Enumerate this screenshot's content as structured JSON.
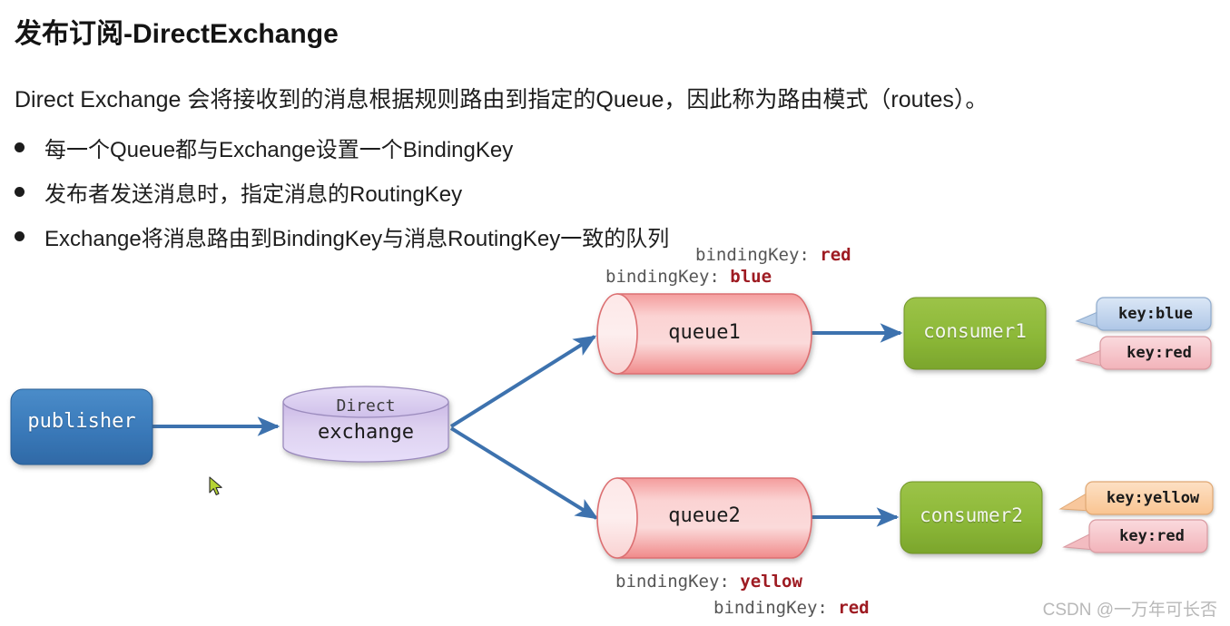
{
  "slide": {
    "title": "发布订阅-DirectExchange",
    "lead": "Direct Exchange 会将接收到的消息根据规则路由到指定的Queue，因此称为路由模式（routes）。",
    "bullets": [
      "每一个Queue都与Exchange设置一个BindingKey",
      "发布者发送消息时，指定消息的RoutingKey",
      "Exchange将消息路由到BindingKey与消息RoutingKey一致的队列"
    ]
  },
  "diagram": {
    "publisher": {
      "label": "publisher",
      "color": "#3d7cbd"
    },
    "exchange": {
      "line1": "Direct",
      "line2": "exchange",
      "color": "#d4c6e8"
    },
    "queues": [
      {
        "label": "queue1",
        "color": "#f5a2a2"
      },
      {
        "label": "queue2",
        "color": "#f5a2a2"
      }
    ],
    "consumers": [
      {
        "label": "consumer1",
        "color": "#8cb838"
      },
      {
        "label": "consumer2",
        "color": "#8cb838"
      }
    ],
    "binding_notes": [
      {
        "prefix": "bindingKey: ",
        "value": "red"
      },
      {
        "prefix": "bindingKey: ",
        "value": "blue"
      },
      {
        "prefix": "bindingKey: ",
        "value": "yellow"
      },
      {
        "prefix": "bindingKey: ",
        "value": "red"
      }
    ],
    "callouts": [
      {
        "label": "key:blue",
        "color": "#c3d6ef"
      },
      {
        "label": "key:red",
        "color": "#f6c4c8"
      },
      {
        "label": "key:yellow",
        "color": "#f8ceا9"
      },
      {
        "label": "key:red",
        "color": "#f6c4c8"
      }
    ],
    "arrow_color": "#3d72ae"
  },
  "watermark": "CSDN @一万年可长否"
}
